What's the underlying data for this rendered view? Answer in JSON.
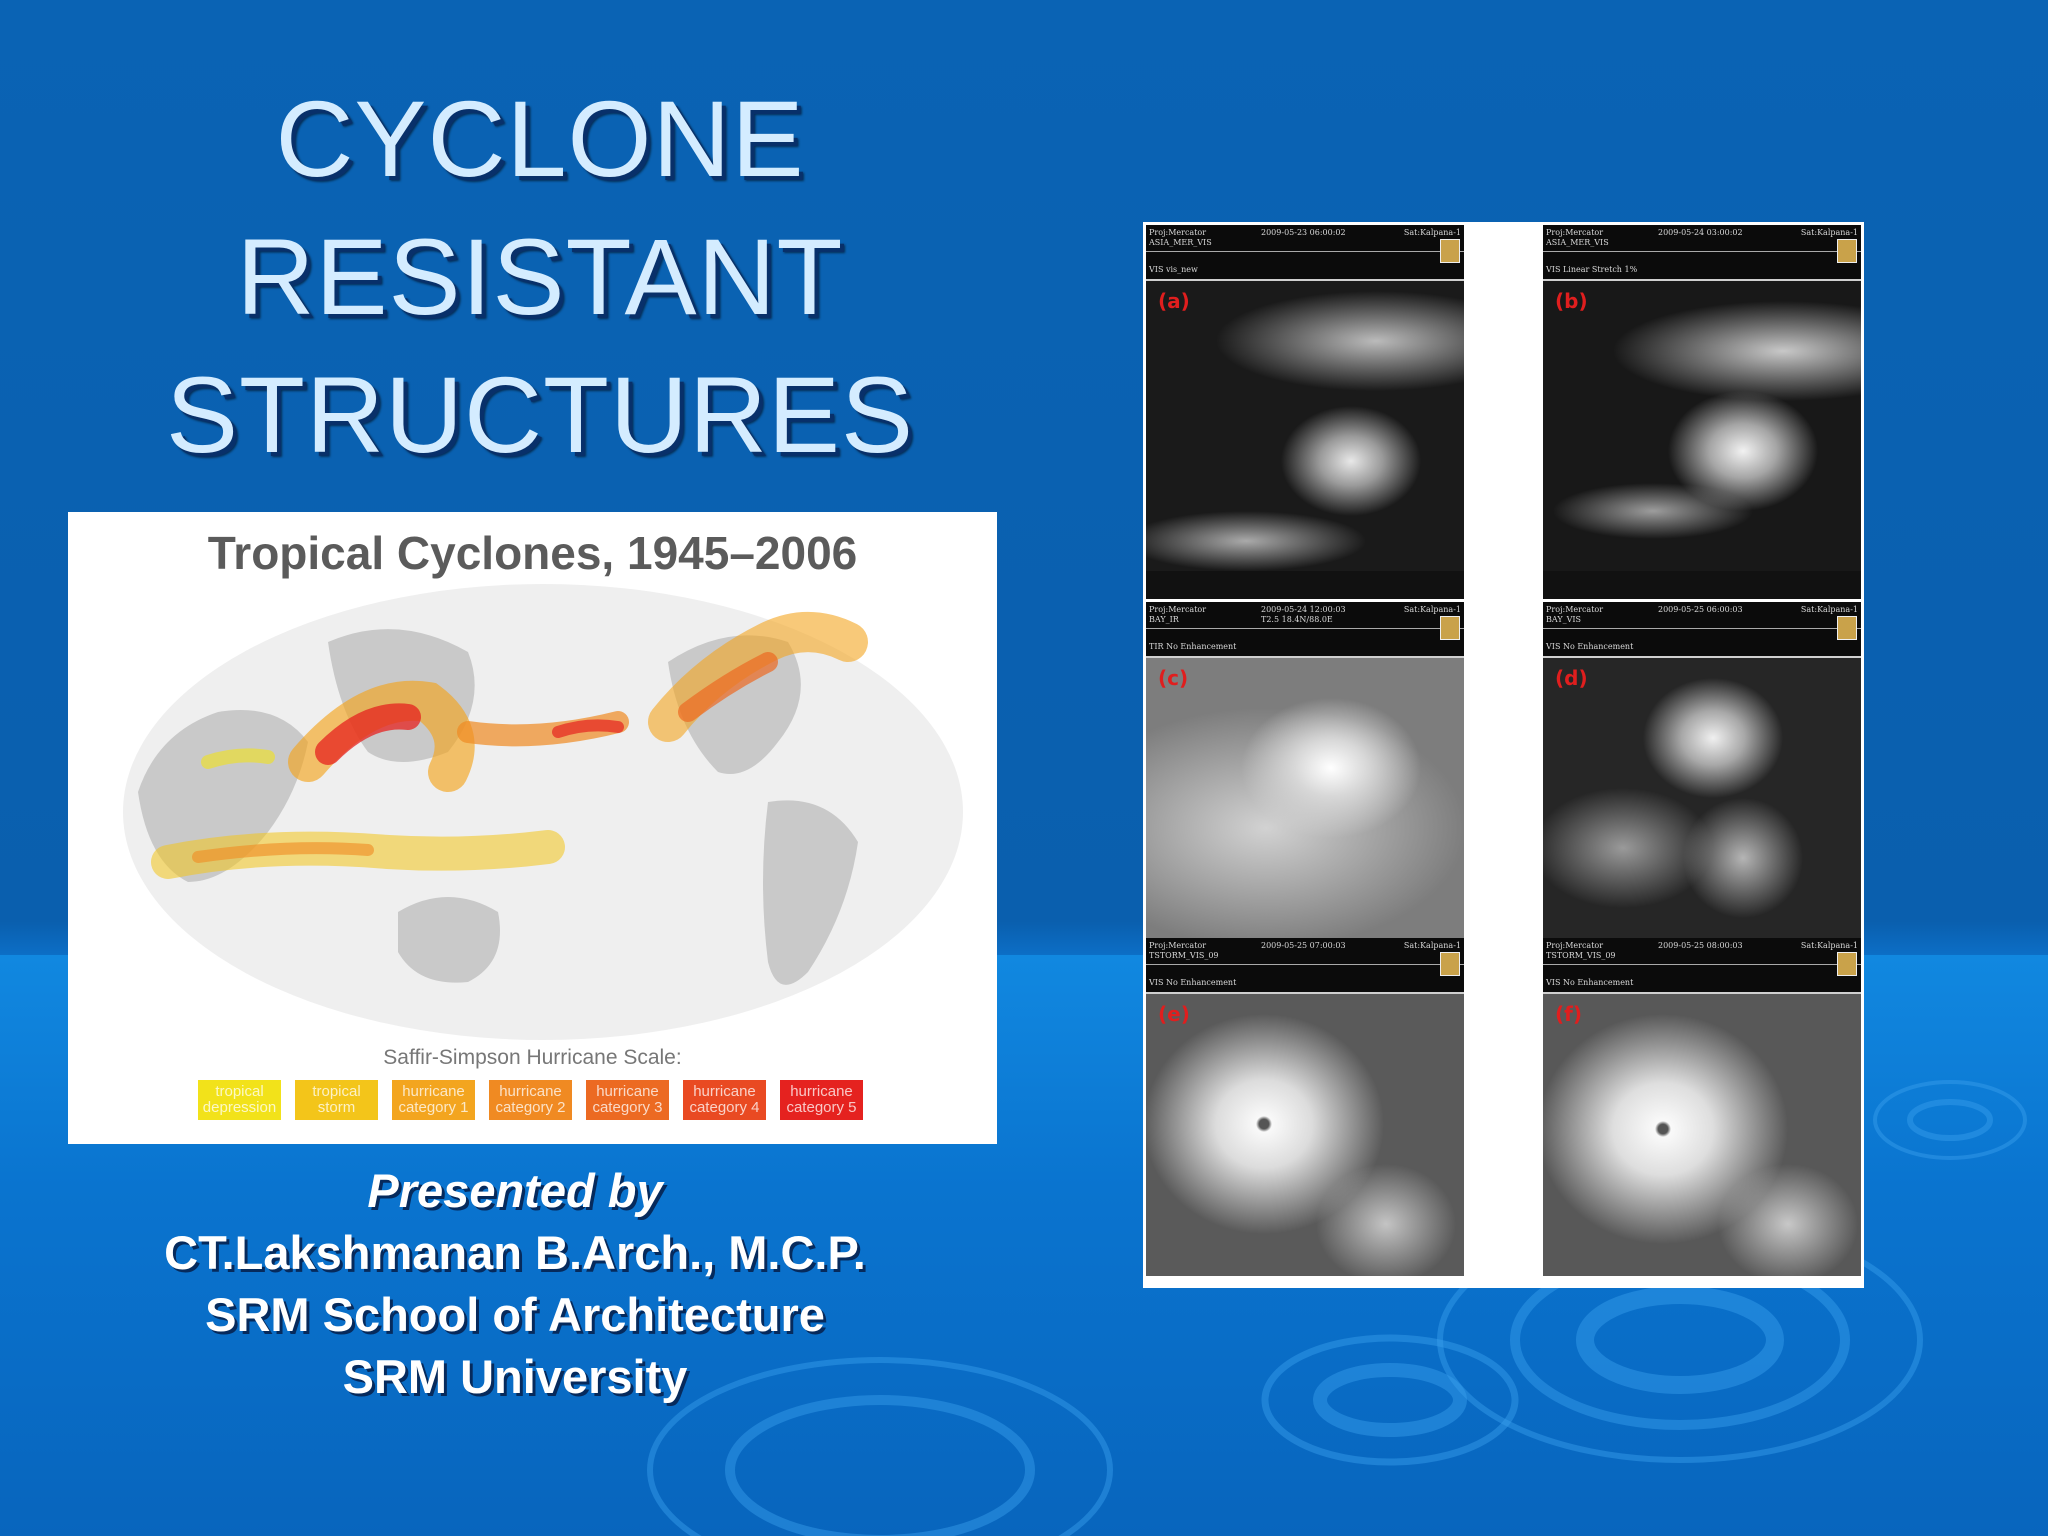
{
  "slide": {
    "title_lines": [
      "CYCLONE",
      "RESISTANT",
      "STRUCTURES"
    ],
    "presenter": {
      "label": "Presented by",
      "name": "CT.Lakshmanan B.Arch., M.C.P.",
      "school": "SRM School of Architecture",
      "university": "SRM University"
    }
  },
  "map_figure": {
    "title": "Tropical Cyclones, 1945–2006",
    "scale_title": "Saffir-Simpson Hurricane Scale:",
    "scale_items": [
      {
        "label": "tropical depression",
        "color": "#f2e21a"
      },
      {
        "label": "tropical storm",
        "color": "#f3c51a"
      },
      {
        "label": "hurricane category 1",
        "color": "#f3a51f"
      },
      {
        "label": "hurricane category 2",
        "color": "#f08a22"
      },
      {
        "label": "hurricane category 3",
        "color": "#ec6a22"
      },
      {
        "label": "hurricane category 4",
        "color": "#e94a22"
      },
      {
        "label": "hurricane category 5",
        "color": "#e5221f"
      }
    ]
  },
  "satellite_figure": {
    "panels": [
      {
        "label": "(a)",
        "proj": "Proj:Mercator",
        "product": "ASIA_MER_VIS",
        "datetime": "2009-05-23 06:00:02",
        "satellite": "Sat:Kalpana-1",
        "enhancement": "VIS vis_new",
        "extra": ""
      },
      {
        "label": "(b)",
        "proj": "Proj:Mercator",
        "product": "ASIA_MER_VIS",
        "datetime": "2009-05-24 03:00:02",
        "satellite": "Sat:Kalpana-1",
        "enhancement": "VIS Linear Stretch 1%",
        "extra": ""
      },
      {
        "label": "(c)",
        "proj": "Proj:Mercator",
        "product": "BAY_IR",
        "datetime": "2009-05-24 12:00:03",
        "satellite": "Sat:Kalpana-1",
        "enhancement": "TIR No Enhancement",
        "extra": "T2.5  18.4N/88.0E"
      },
      {
        "label": "(d)",
        "proj": "Proj:Mercator",
        "product": "BAY_VIS",
        "datetime": "2009-05-25 06:00:03",
        "satellite": "Sat:Kalpana-1",
        "enhancement": "VIS No Enhancement",
        "extra": ""
      },
      {
        "label": "(e)",
        "proj": "Proj:Mercator",
        "product": "TSTORM_VIS_09",
        "datetime": "2009-05-25 07:00:03",
        "satellite": "Sat:Kalpana-1",
        "enhancement": "VIS No Enhancement",
        "extra": ""
      },
      {
        "label": "(f)",
        "proj": "Proj:Mercator",
        "product": "TSTORM_VIS_09",
        "datetime": "2009-05-25 08:00:03",
        "satellite": "Sat:Kalpana-1",
        "enhancement": "VIS No Enhancement",
        "extra": ""
      }
    ]
  }
}
